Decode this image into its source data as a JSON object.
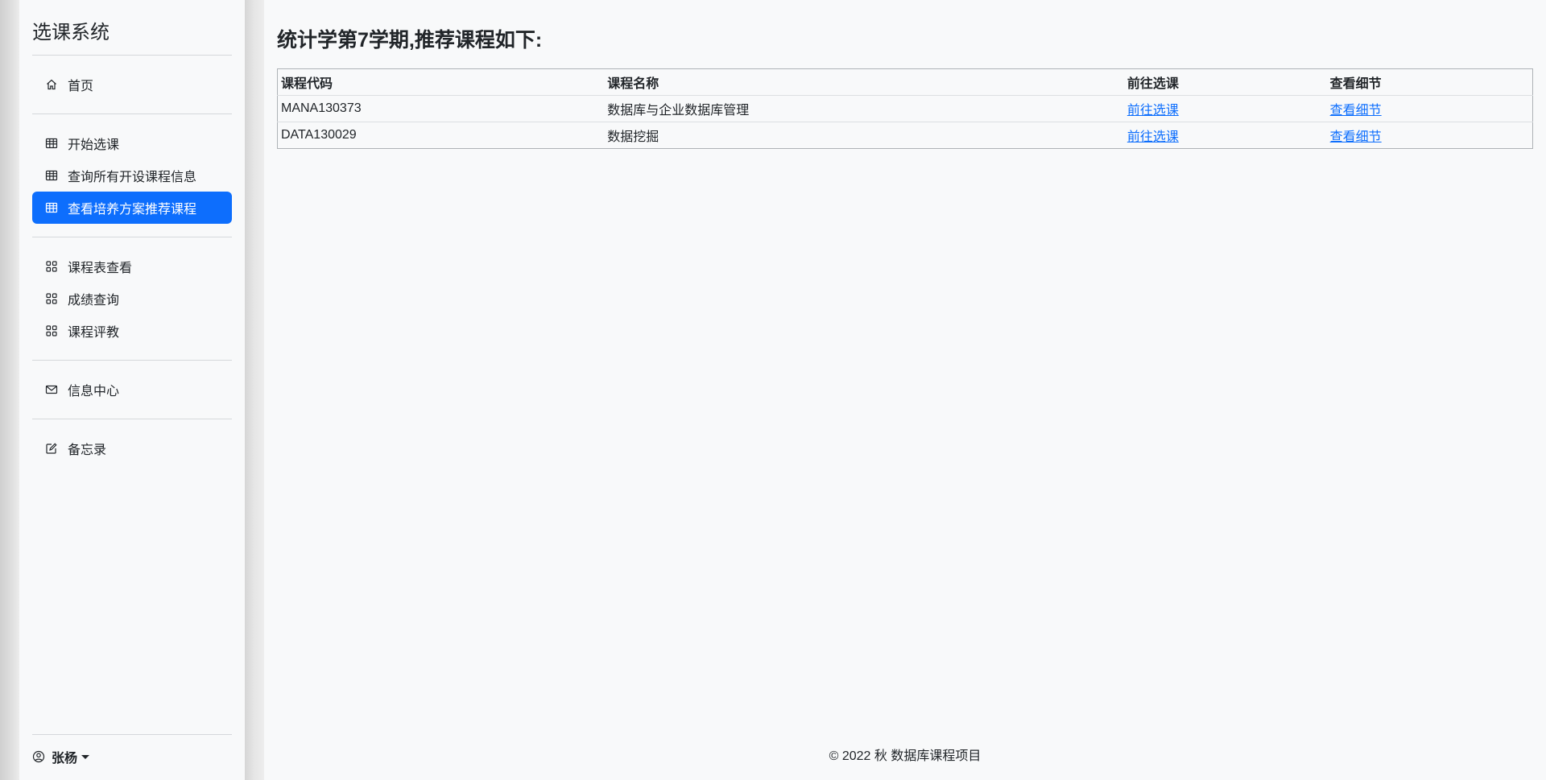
{
  "sidebar": {
    "brand": "选课系统",
    "items": [
      {
        "label": "首页",
        "icon": "house-icon"
      },
      {
        "label": "开始选课",
        "icon": "table-icon"
      },
      {
        "label": "查询所有开设课程信息",
        "icon": "table-icon"
      },
      {
        "label": "查看培养方案推荐课程",
        "icon": "table-icon",
        "active": true
      },
      {
        "label": "课程表查看",
        "icon": "grid-icon"
      },
      {
        "label": "成绩查询",
        "icon": "grid-icon"
      },
      {
        "label": "课程评教",
        "icon": "grid-icon"
      },
      {
        "label": "信息中心",
        "icon": "envelope-icon"
      },
      {
        "label": "备忘录",
        "icon": "pencil-square-icon"
      }
    ],
    "user": {
      "name": "张杨",
      "icon": "person-circle-icon"
    }
  },
  "main": {
    "title": "统计学第7学期,推荐课程如下:",
    "table": {
      "headers": [
        "课程代码",
        "课程名称",
        "前往选课",
        "查看细节"
      ],
      "rows": [
        {
          "code": "MANA130373",
          "name": "数据库与企业数据库管理",
          "enroll_link": "前往选课",
          "detail_link": "查看细节"
        },
        {
          "code": "DATA130029",
          "name": "数据挖掘",
          "enroll_link": "前往选课",
          "detail_link": "查看细节"
        }
      ]
    }
  },
  "footer": {
    "text": "© 2022 秋 数据库课程项目"
  },
  "colors": {
    "accent": "#0d6efd",
    "background": "#f8f9fa"
  }
}
